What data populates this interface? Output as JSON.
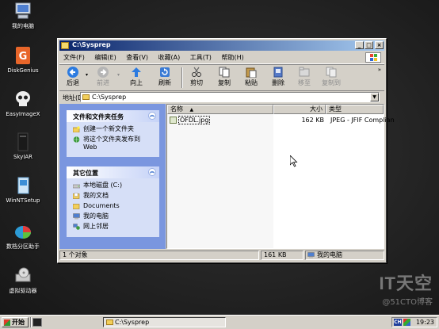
{
  "desktop": {
    "icons": [
      {
        "label": "我的电脑",
        "icon": "computer-icon"
      },
      {
        "label": "DiskGenius",
        "icon": "diskgenius-icon"
      },
      {
        "label": "EasyImageX",
        "icon": "skull-icon"
      },
      {
        "label": "SkyIAR",
        "icon": "skyiar-icon"
      },
      {
        "label": "WinNTSetup",
        "icon": "winntsetup-icon"
      },
      {
        "label": "数档分区助手",
        "icon": "partition-icon"
      },
      {
        "label": "虚拟驱动器",
        "icon": "virtual-drive-icon"
      }
    ],
    "watermark": {
      "logo": "IT天空",
      "sub": "@51CTO博客"
    }
  },
  "window": {
    "title": "C:\\Sysprep",
    "buttons": {
      "minimize": "_",
      "maximize": "□",
      "close": "×"
    },
    "menu": [
      "文件(F)",
      "编辑(E)",
      "查看(V)",
      "收藏(A)",
      "工具(T)",
      "帮助(H)"
    ],
    "toolbar": {
      "back": "后退",
      "forward": "前进",
      "up": "向上",
      "refresh": "刷新",
      "cut": "剪切",
      "copy": "复制",
      "paste": "粘贴",
      "delete": "删除",
      "move_to": "移至",
      "copy_to": "复制到"
    },
    "address": {
      "label": "地址(D)",
      "value": "C:\\Sysprep"
    },
    "task_pane": {
      "file_tasks": {
        "title": "文件和文件夹任务",
        "items": [
          "创建一个新文件夹",
          "将这个文件夹发布到 Web"
        ]
      },
      "other_places": {
        "title": "其它位置",
        "items": [
          "本地磁盘 (C:)",
          "我的文档",
          "Documents",
          "我的电脑",
          "网上邻居"
        ]
      }
    },
    "file_list": {
      "columns": {
        "name": "名称",
        "sort_indicator": "▲",
        "size": "大小",
        "type": "类型"
      },
      "files": [
        {
          "name": "OFDL.jpg",
          "size": "162 KB",
          "type": "JPEG - JFIF Complian"
        }
      ]
    },
    "status": {
      "count": "1 个对象",
      "size": "161 KB",
      "location": "我的电脑"
    }
  },
  "taskbar": {
    "start_label": "开始",
    "task_button": "C:\\Sysprep",
    "tray": {
      "lang": "CH",
      "clock": "19:23"
    }
  }
}
